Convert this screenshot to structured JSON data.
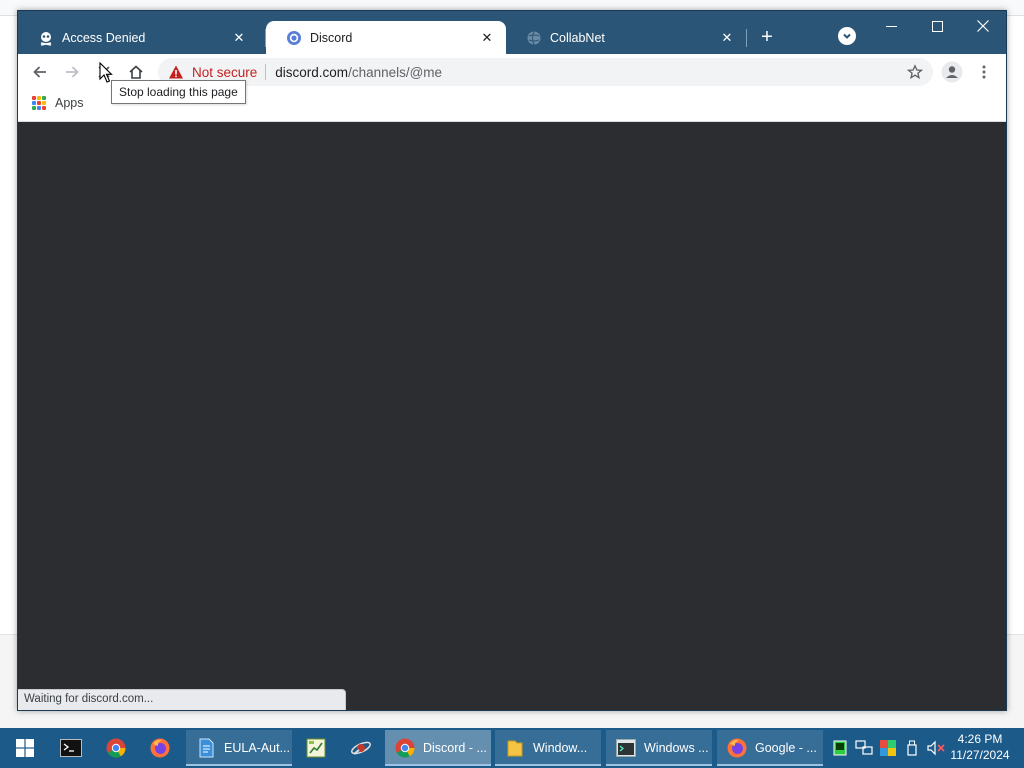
{
  "browser": {
    "tabs": [
      {
        "label": "Access Denied",
        "active": false
      },
      {
        "label": "Discord",
        "active": true
      },
      {
        "label": "CollabNet",
        "active": false
      }
    ],
    "new_tab_symbol": "+",
    "window_controls": {
      "minimize": "—",
      "maximize": "☐",
      "close": "✕"
    }
  },
  "toolbar": {
    "security_label": "Not secure",
    "url_host": "discord.com",
    "url_path": "/channels/@me",
    "tooltip": "Stop loading this page"
  },
  "bookmarks": {
    "apps_label": "Apps",
    "apps_colors": [
      "#ea4335",
      "#fbbc04",
      "#34a853",
      "#4285f4",
      "#ea4335",
      "#fbbc04",
      "#34a853",
      "#4285f4",
      "#ea4335"
    ]
  },
  "page": {
    "background_color": "#2b2d31",
    "status_text": "Waiting for discord.com..."
  },
  "taskbar": {
    "items": [
      {
        "label": "EULA-Aut...",
        "icon": "document-icon"
      },
      {
        "label": "Discord - ...",
        "icon": "chrome-icon"
      },
      {
        "label": "Window...",
        "icon": "folder-icon"
      },
      {
        "label": "Windows ...",
        "icon": "terminal-window-icon"
      },
      {
        "label": "Google - ...",
        "icon": "firefox-icon"
      }
    ],
    "clock_time": "4:26 PM",
    "clock_date": "11/27/2024"
  },
  "colors": {
    "titlebar": "#2b5576",
    "taskbar": "#1c5a8a",
    "not_secure": "#c5221f"
  }
}
